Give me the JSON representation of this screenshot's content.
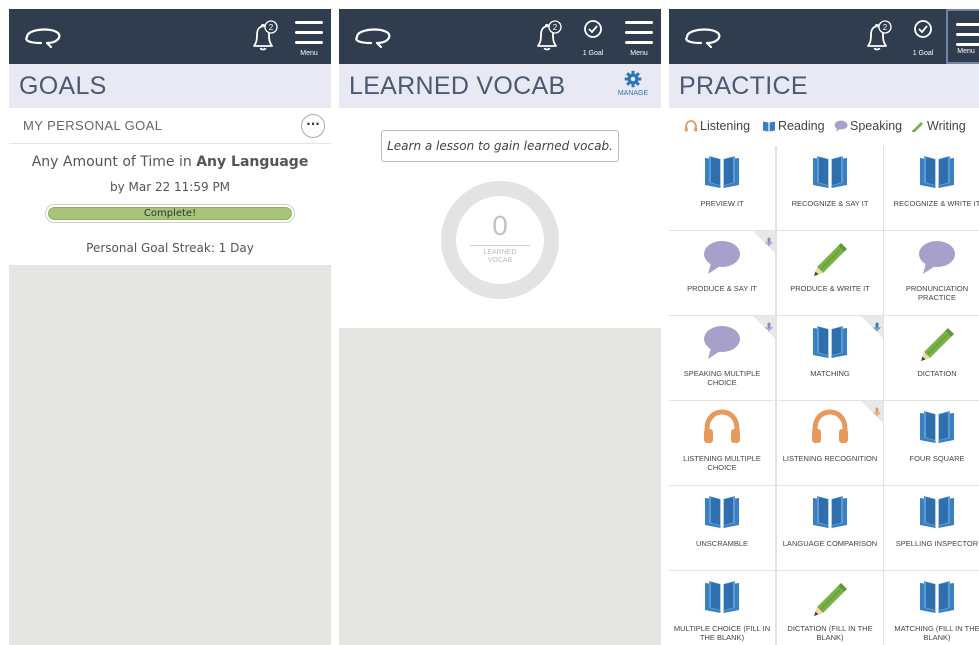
{
  "header": {
    "notification_count": "2",
    "menu_label": "Menu",
    "goal_label": "1 Goal"
  },
  "goals_screen": {
    "title": "GOALS",
    "section_title": "MY PERSONAL GOAL",
    "more_label": "···",
    "goal_prefix": "Any Amount of Time",
    "goal_in": "in",
    "goal_language": "Any Language",
    "goal_date": "by Mar 22 11:59 PM",
    "progress_label": "Complete!",
    "progress_value": 1.0,
    "streak": "Personal Goal Streak: 1 Day"
  },
  "vocab_screen": {
    "title": "LEARNED VOCAB",
    "manage_label": "MANAGE",
    "empty_message": "Learn a lesson to gain learned vocab.",
    "count": "0",
    "count_label_line1": "LEARNED",
    "count_label_line2": "VOCAB"
  },
  "practice_screen": {
    "title": "PRACTICE",
    "skills": [
      {
        "label": "Listening",
        "icon": "headphones-icon"
      },
      {
        "label": "Reading",
        "icon": "book-icon"
      },
      {
        "label": "Speaking",
        "icon": "speech-bubble-icon"
      },
      {
        "label": "Writing",
        "icon": "pencil-icon"
      }
    ],
    "activities": [
      {
        "label": "PREVIEW IT",
        "icon": "book"
      },
      {
        "label": "RECOGNIZE & SAY IT",
        "icon": "book"
      },
      {
        "label": "RECOGNIZE & WRITE IT",
        "icon": "book"
      },
      {
        "label": "PRODUCE & SAY IT",
        "icon": "speech",
        "corner": "mic"
      },
      {
        "label": "PRODUCE & WRITE IT",
        "icon": "pencil"
      },
      {
        "label": "PRONUNCIATION PRACTICE",
        "icon": "speech"
      },
      {
        "label": "SPEAKING MULTIPLE CHOICE",
        "icon": "speech",
        "corner": "mic"
      },
      {
        "label": "MATCHING",
        "icon": "book",
        "corner": "mic-blue"
      },
      {
        "label": "DICTATION",
        "icon": "pencil"
      },
      {
        "label": "LISTENING MULTIPLE CHOICE",
        "icon": "headphones"
      },
      {
        "label": "LISTENING RECOGNITION",
        "icon": "headphones",
        "corner": "mic-orange"
      },
      {
        "label": "FOUR SQUARE",
        "icon": "book"
      },
      {
        "label": "UNSCRAMBLE",
        "icon": "book"
      },
      {
        "label": "LANGUAGE COMPARISON",
        "icon": "book"
      },
      {
        "label": "SPELLING INSPECTOR",
        "icon": "book"
      },
      {
        "label": "MULTIPLE CHOICE (FILL IN THE BLANK)",
        "icon": "book"
      },
      {
        "label": "DICTATION (FILL IN THE BLANK)",
        "icon": "pencil"
      },
      {
        "label": "MATCHING (FILL IN THE BLANK)",
        "icon": "book"
      }
    ]
  },
  "colors": {
    "header_bg": "#2f3d4f",
    "title_bg": "#e9e9f4",
    "book_blue": "#3a7fc1",
    "speech_purple": "#a99fcb",
    "pencil_green": "#79b14a",
    "headphones_orange": "#e89a5c",
    "progress_green": "#a6c57a"
  }
}
